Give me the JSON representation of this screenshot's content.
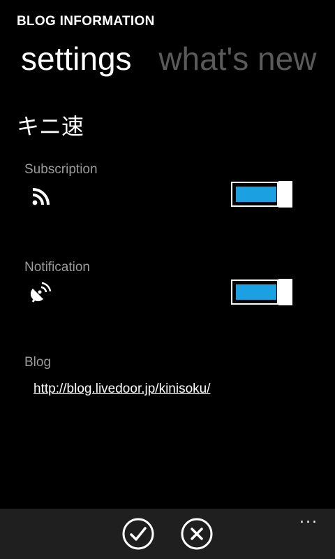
{
  "header": {
    "app_title": "BLOG INFORMATION",
    "pivots": [
      {
        "label": "settings",
        "active": true
      },
      {
        "label": "what's new",
        "active": false
      }
    ]
  },
  "blog": {
    "name": "キニ速"
  },
  "subscription": {
    "label": "Subscription",
    "icon": "rss-icon",
    "enabled": true
  },
  "notification": {
    "label": "Notification",
    "icon": "satellite-dish-icon",
    "enabled": true
  },
  "blog_link": {
    "label": "Blog",
    "url": "http://blog.livedoor.jp/kinisoku/"
  },
  "app_bar": {
    "buttons": [
      "check-icon",
      "close-icon"
    ],
    "more_glyph": "..."
  },
  "colors": {
    "accent": "#1ba1e2",
    "background": "#000000",
    "app_bar": "#1f1f1f",
    "inactive_pivot": "#5a5a5a",
    "label": "#9a9a9a"
  }
}
